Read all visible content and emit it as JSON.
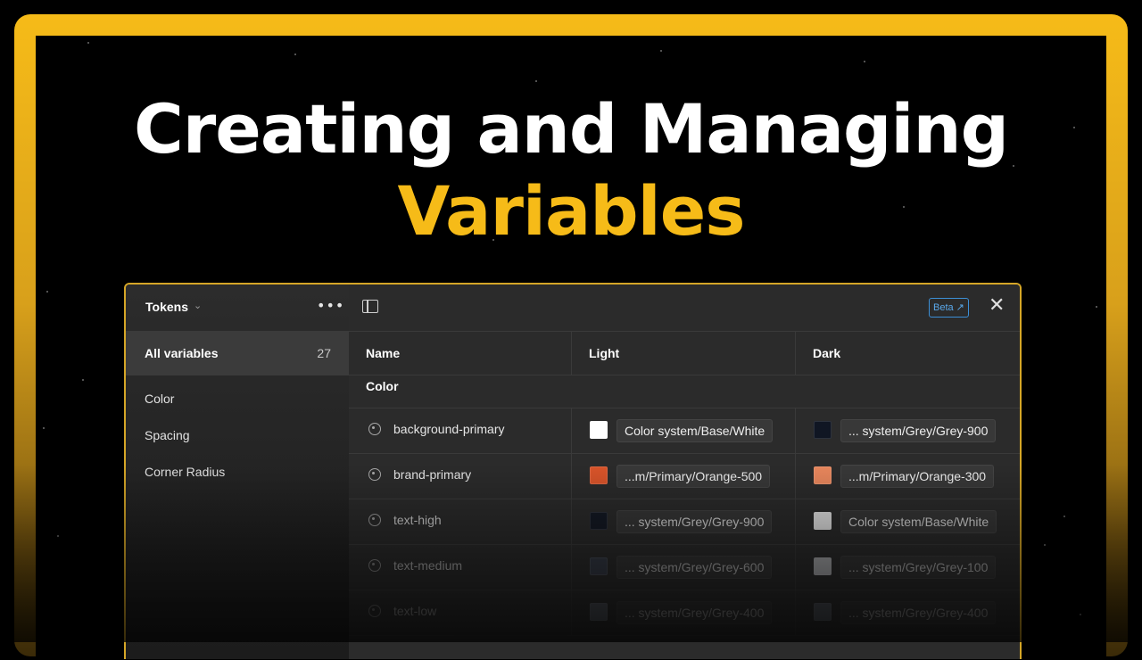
{
  "headline": {
    "line1": "Creating and Managing",
    "line2": "Variables"
  },
  "colors": {
    "accent": "#f6bb18",
    "panel_bg": "#2b2b2b",
    "beta_blue": "#3c8fd6"
  },
  "sidebar": {
    "collection_title": "Tokens",
    "collection_chevron": "⌄",
    "more_icon": "•••",
    "all_variables": {
      "label": "All variables",
      "count": "27"
    },
    "groups": [
      "Color",
      "Spacing",
      "Corner Radius"
    ]
  },
  "toolbar": {
    "layout_icon": "sidebar-panel-icon",
    "beta_label": "Beta ↗",
    "close_icon": "✕"
  },
  "table": {
    "columns": [
      "Name",
      "Light",
      "Dark"
    ],
    "group_label": "Color",
    "rows": [
      {
        "name": "background-primary",
        "light": {
          "swatch": "#ffffff",
          "ref": "Color system/Base/White"
        },
        "dark": {
          "swatch": "#101623",
          "ref": "... system/Grey/Grey-900"
        }
      },
      {
        "name": "brand-primary",
        "light": {
          "swatch": "#d9542a",
          "ref": "...m/Primary/Orange-500"
        },
        "dark": {
          "swatch": "#e8865c",
          "ref": "...m/Primary/Orange-300"
        }
      },
      {
        "name": "text-high",
        "light": {
          "swatch": "#101623",
          "ref": "... system/Grey/Grey-900"
        },
        "dark": {
          "swatch": "#ffffff",
          "ref": "Color system/Base/White"
        }
      },
      {
        "name": "text-medium",
        "light": {
          "swatch": "#3a4354",
          "ref": "... system/Grey/Grey-600"
        },
        "dark": {
          "swatch": "#e8eaee",
          "ref": "... system/Grey/Grey-100"
        }
      },
      {
        "name": "text-low",
        "light": {
          "swatch": "#737b8a",
          "ref": "... system/Grey/Grey-400"
        },
        "dark": {
          "swatch": "#737b8a",
          "ref": "... system/Grey/Grey-400"
        }
      }
    ]
  }
}
